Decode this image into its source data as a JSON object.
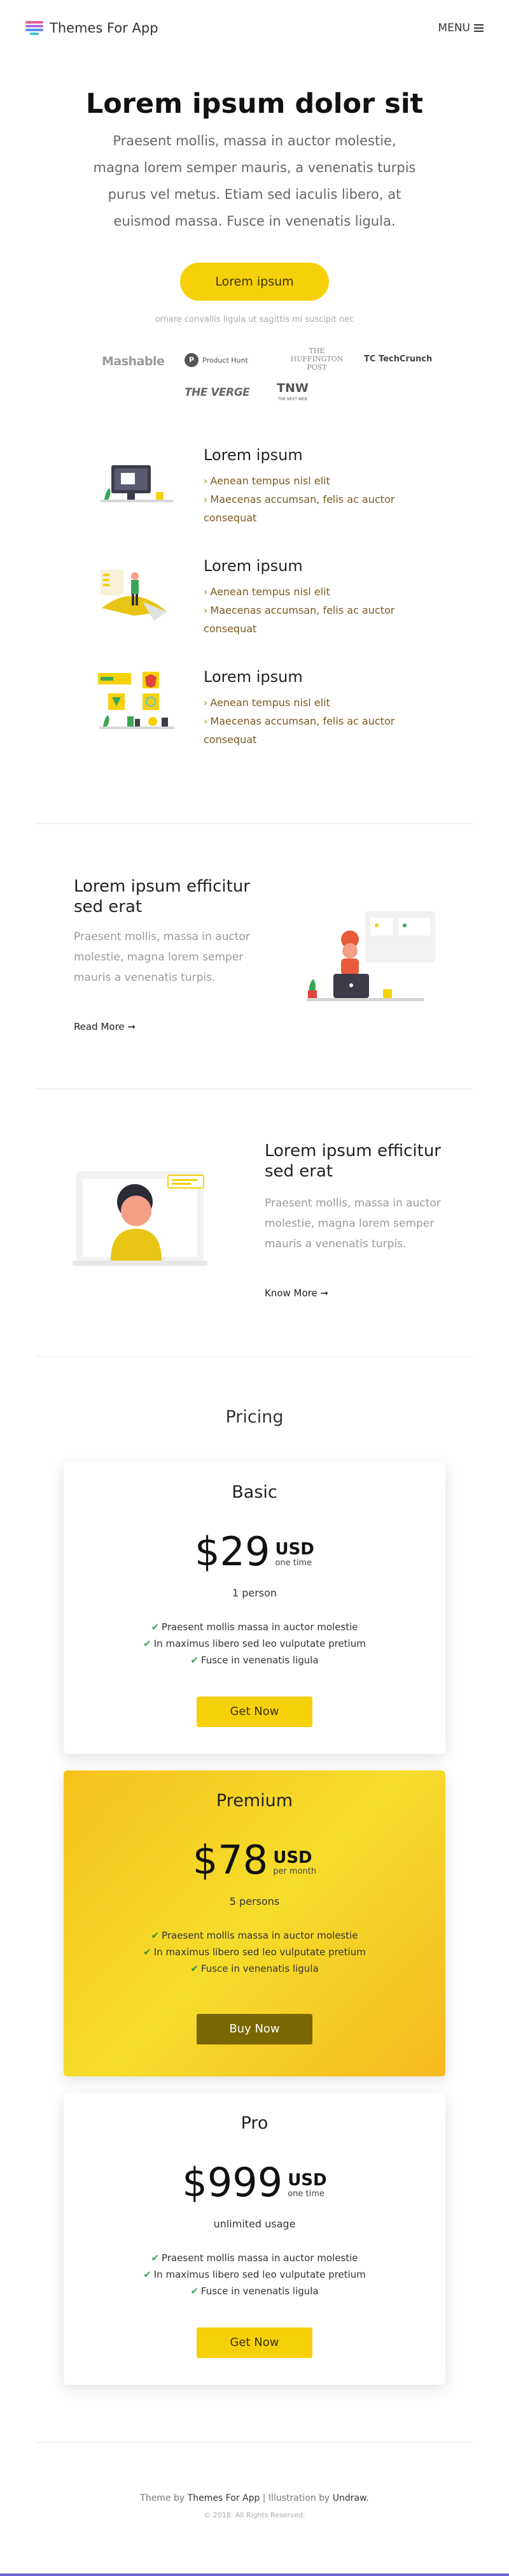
{
  "header": {
    "brand": "Themes For App",
    "menu_label": "MENU"
  },
  "hero": {
    "title": "Lorem ipsum dolor sit",
    "subtitle": "Praesent mollis, massa in auctor molestie, magna lorem semper mauris, a venenatis turpis purus vel metus. Etiam sed iaculis libero, at euismod massa. Fusce in venenatis ligula.",
    "button": "Lorem ipsum",
    "note": "ornare convallis ligula ut sagittis mi suscipit nec"
  },
  "press_logos": {
    "mashable": "Mashable",
    "producthunt": "Product Hunt",
    "producthunt_letter": "P",
    "huffington": "THE HUFFINGTON POST",
    "techcrunch": "TechCrunch",
    "techcrunch_mark": "TC",
    "verge": "THE VERGE",
    "tnw": "TNW",
    "tnw_small": "THE NEXT WEB"
  },
  "features": [
    {
      "title": "Lorem ipsum",
      "items": [
        "Aenean tempus nisl elit",
        "Maecenas accumsan, felis ac auctor consequat"
      ]
    },
    {
      "title": "Lorem ipsum",
      "items": [
        "Aenean tempus nisl elit",
        "Maecenas accumsan, felis ac auctor consequat"
      ]
    },
    {
      "title": "Lorem ipsum",
      "items": [
        "Aenean tempus nisl elit",
        "Maecenas accumsan, felis ac auctor consequat"
      ]
    }
  ],
  "story1": {
    "title": "Lorem ipsum efficitur sed erat",
    "text": "Praesent mollis, massa in auctor molestie, magna lorem semper mauris a venenatis turpis.",
    "link": "Read More"
  },
  "story2": {
    "title": "Lorem ipsum efficitur sed erat",
    "text": "Praesent mollis, massa in auctor molestie, magna lorem semper mauris a venenatis turpis.",
    "link": "Know More"
  },
  "pricing": {
    "heading": "Pricing",
    "plans": [
      {
        "name": "Basic",
        "amount": "$29",
        "currency": "USD",
        "period": "one time",
        "persons": "1 person",
        "features": [
          "Praesent mollis massa in auctor molestie",
          "In maximus libero sed leo vulputate pretium",
          "Fusce in venenatis ligula"
        ],
        "button": "Get Now"
      },
      {
        "name": "Premium",
        "amount": "$78",
        "currency": "USD",
        "period": "per month",
        "persons": "5 persons",
        "features": [
          "Praesent mollis massa in auctor molestie",
          "In maximus libero sed leo vulputate pretium",
          "Fusce in venenatis ligula"
        ],
        "button": "Buy Now"
      },
      {
        "name": "Pro",
        "amount": "$999",
        "currency": "USD",
        "period": "one time",
        "persons": "unlimited usage",
        "features": [
          "Praesent mollis massa in auctor molestie",
          "In maximus libero sed leo vulputate pretium",
          "Fusce in venenatis ligula"
        ],
        "button": "Get Now"
      }
    ]
  },
  "footer": {
    "prefix": "Theme by ",
    "theme_link": "Themes For App",
    "separator": " | Illustration by ",
    "illus_link": "Undraw.",
    "copyright": "© 2018. All Rights Reserved."
  },
  "colors": {
    "accent_yellow": "#f6d10a",
    "premium_button": "#7a6600",
    "check_green": "#3aa655",
    "bottom_bar": "#6b67d6"
  },
  "icons": [
    "hamburger-icon",
    "chevron-right-icon",
    "check-icon",
    "arrow-right-icon"
  ]
}
